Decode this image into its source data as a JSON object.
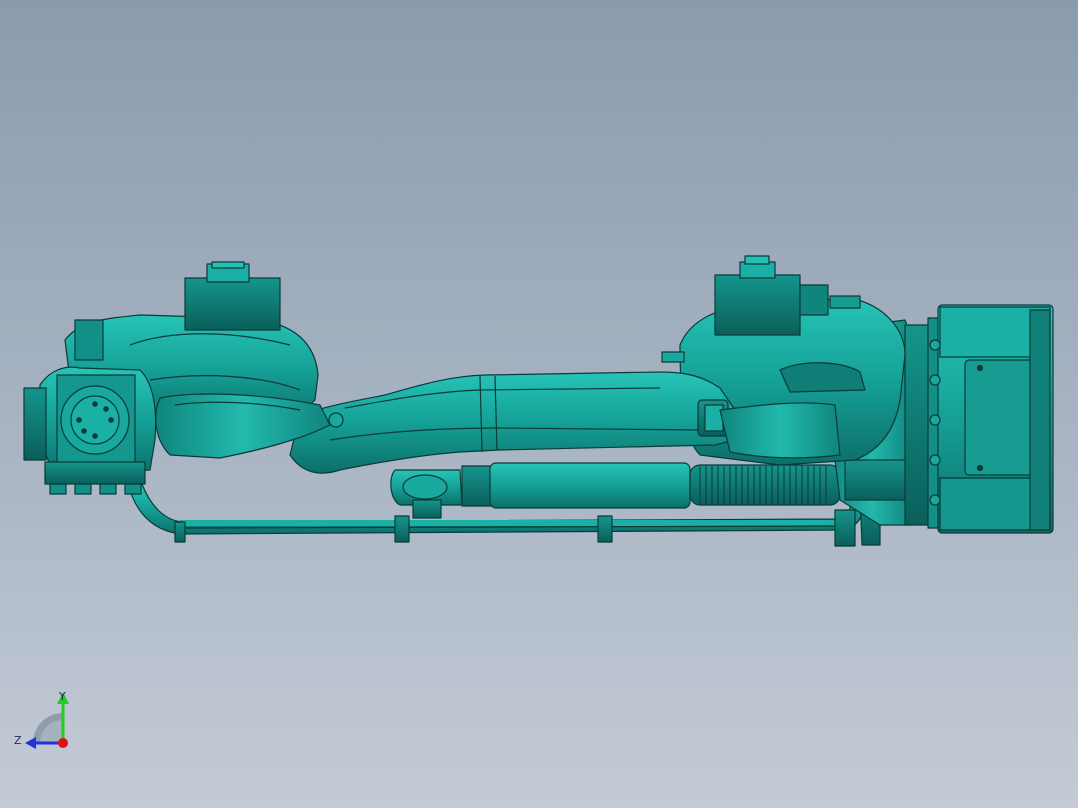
{
  "viewport": {
    "background_top": "#8a9bae",
    "background_bottom": "#c4cbd6",
    "model_color": "#1aa39a",
    "model_edge_color": "#0a3b38"
  },
  "triad": {
    "y_label": "Y",
    "z_label": "Z",
    "y_axis_color": "#22cc22",
    "z_axis_color": "#2233dd",
    "x_axis_color": "#dd1111"
  }
}
